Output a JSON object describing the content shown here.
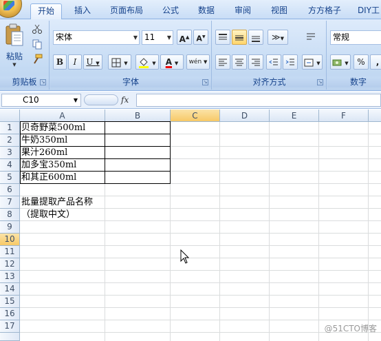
{
  "tabs": [
    "开始",
    "插入",
    "页面布局",
    "公式",
    "数据",
    "审阅",
    "视图",
    "方方格子",
    "DIY工"
  ],
  "clipboard": {
    "paste_label": "粘贴",
    "group_label": "剪贴板"
  },
  "font": {
    "name": "宋体",
    "size": "11",
    "grow": "A",
    "shrink": "A",
    "bold": "B",
    "italic": "I",
    "underline": "U",
    "font_color_letter": "A",
    "phonetic": "wén",
    "group_label": "字体"
  },
  "alignment": {
    "group_label": "对齐方式"
  },
  "number": {
    "format": "常规",
    "percent": "%",
    "comma": ",",
    "group_label": "数字"
  },
  "formula_bar": {
    "cell_ref": "C10",
    "fx": "fx",
    "value": ""
  },
  "columns": [
    "A",
    "B",
    "C",
    "D",
    "E",
    "F"
  ],
  "rows": [
    "1",
    "2",
    "3",
    "4",
    "5",
    "6",
    "7",
    "8",
    "9",
    "10",
    "11",
    "12",
    "13",
    "14",
    "15",
    "16",
    "17"
  ],
  "cells": {
    "A1": "贝奇野菜500ml",
    "A2": "牛奶350ml",
    "A3": "果汁260ml",
    "A4": "加多宝350ml",
    "A5": "和其正600ml",
    "A7": "批量提取产品名称",
    "A8": "（提取中文）"
  },
  "watermark": "@51CTO博客",
  "colors": {
    "accent": "#15428b",
    "selected_header": "#f7c967"
  }
}
